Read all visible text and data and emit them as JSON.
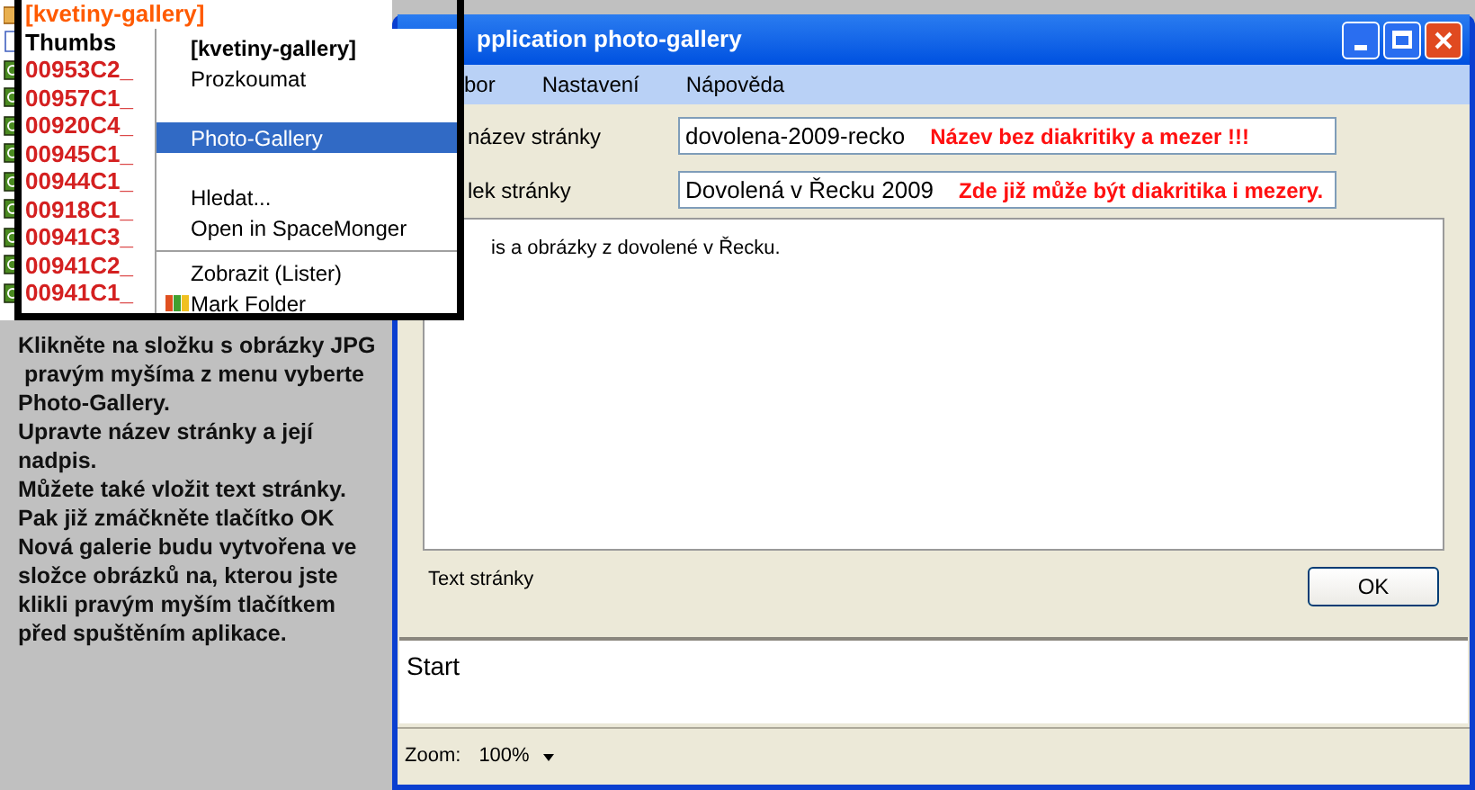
{
  "file_list": {
    "items": [
      {
        "kind": "folder",
        "name": "[kvetiny-gallery]"
      },
      {
        "kind": "document",
        "name": "Thumbs"
      },
      {
        "kind": "image",
        "name": "00953C2_"
      },
      {
        "kind": "image",
        "name": "00957C1_"
      },
      {
        "kind": "image",
        "name": "00920C4_"
      },
      {
        "kind": "image",
        "name": "00945C1_"
      },
      {
        "kind": "image",
        "name": "00944C1_"
      },
      {
        "kind": "image",
        "name": "00918C1_"
      },
      {
        "kind": "image",
        "name": "00941C3_"
      },
      {
        "kind": "image",
        "name": "00941C2_"
      },
      {
        "kind": "image",
        "name": "00941C1_"
      }
    ]
  },
  "context_menu": {
    "groups": [
      {
        "kind": "group",
        "items": [
          {
            "kind": "title",
            "label": "[kvetiny-gallery]",
            "selected": false
          },
          {
            "kind": "item",
            "label": "Prozkoumat",
            "selected": false
          }
        ]
      },
      {
        "kind": "group",
        "items": [
          {
            "kind": "item",
            "label": "Photo-Gallery",
            "selected": true
          }
        ]
      },
      {
        "kind": "group",
        "items": [
          {
            "kind": "item",
            "label": "Hledat...",
            "selected": false
          },
          {
            "kind": "item",
            "label": "Open in SpaceMonger",
            "selected": false
          }
        ]
      },
      {
        "kind": "separator"
      },
      {
        "kind": "group",
        "items": [
          {
            "kind": "item",
            "label": "Zobrazit (Lister)",
            "selected": false
          },
          {
            "kind": "icon_item",
            "label": "Mark Folder",
            "selected": false
          }
        ]
      }
    ]
  },
  "instructions": "Klikněte na složku s obrázky JPG\n pravým myšíma z menu vyberte\nPhoto-Gallery.\nUpravte název stránky a její\nnadpis.\nMůžete také vložit text stránky.\nPak již zmáčkněte tlačítko OK\nNová galerie budu vytvořena ve\nsložce obrázků na, kterou jste\nklikli pravým myším tlačítkem\npřed spuštěním aplikace.",
  "window": {
    "title": "pplication photo-gallery",
    "menu": [
      "bor",
      "Nastavení",
      "Nápověda"
    ],
    "fields": [
      {
        "label": "název stránky",
        "value": "dovolena-2009-recko",
        "hint": "Název bez diakritiky a mezer !!!"
      },
      {
        "label": "lek stránky",
        "value": "Dovolená v Řecku 2009",
        "hint": "Zde již může být diakritika i mezery."
      }
    ],
    "page_text": "is a obrázky z dovolené v Řecku.",
    "page_text_label": "Text stránky",
    "ok_button": "OK",
    "log": "Start",
    "status_bar": {
      "zoom_label": "Zoom:",
      "zoom_value": "100%"
    }
  }
}
